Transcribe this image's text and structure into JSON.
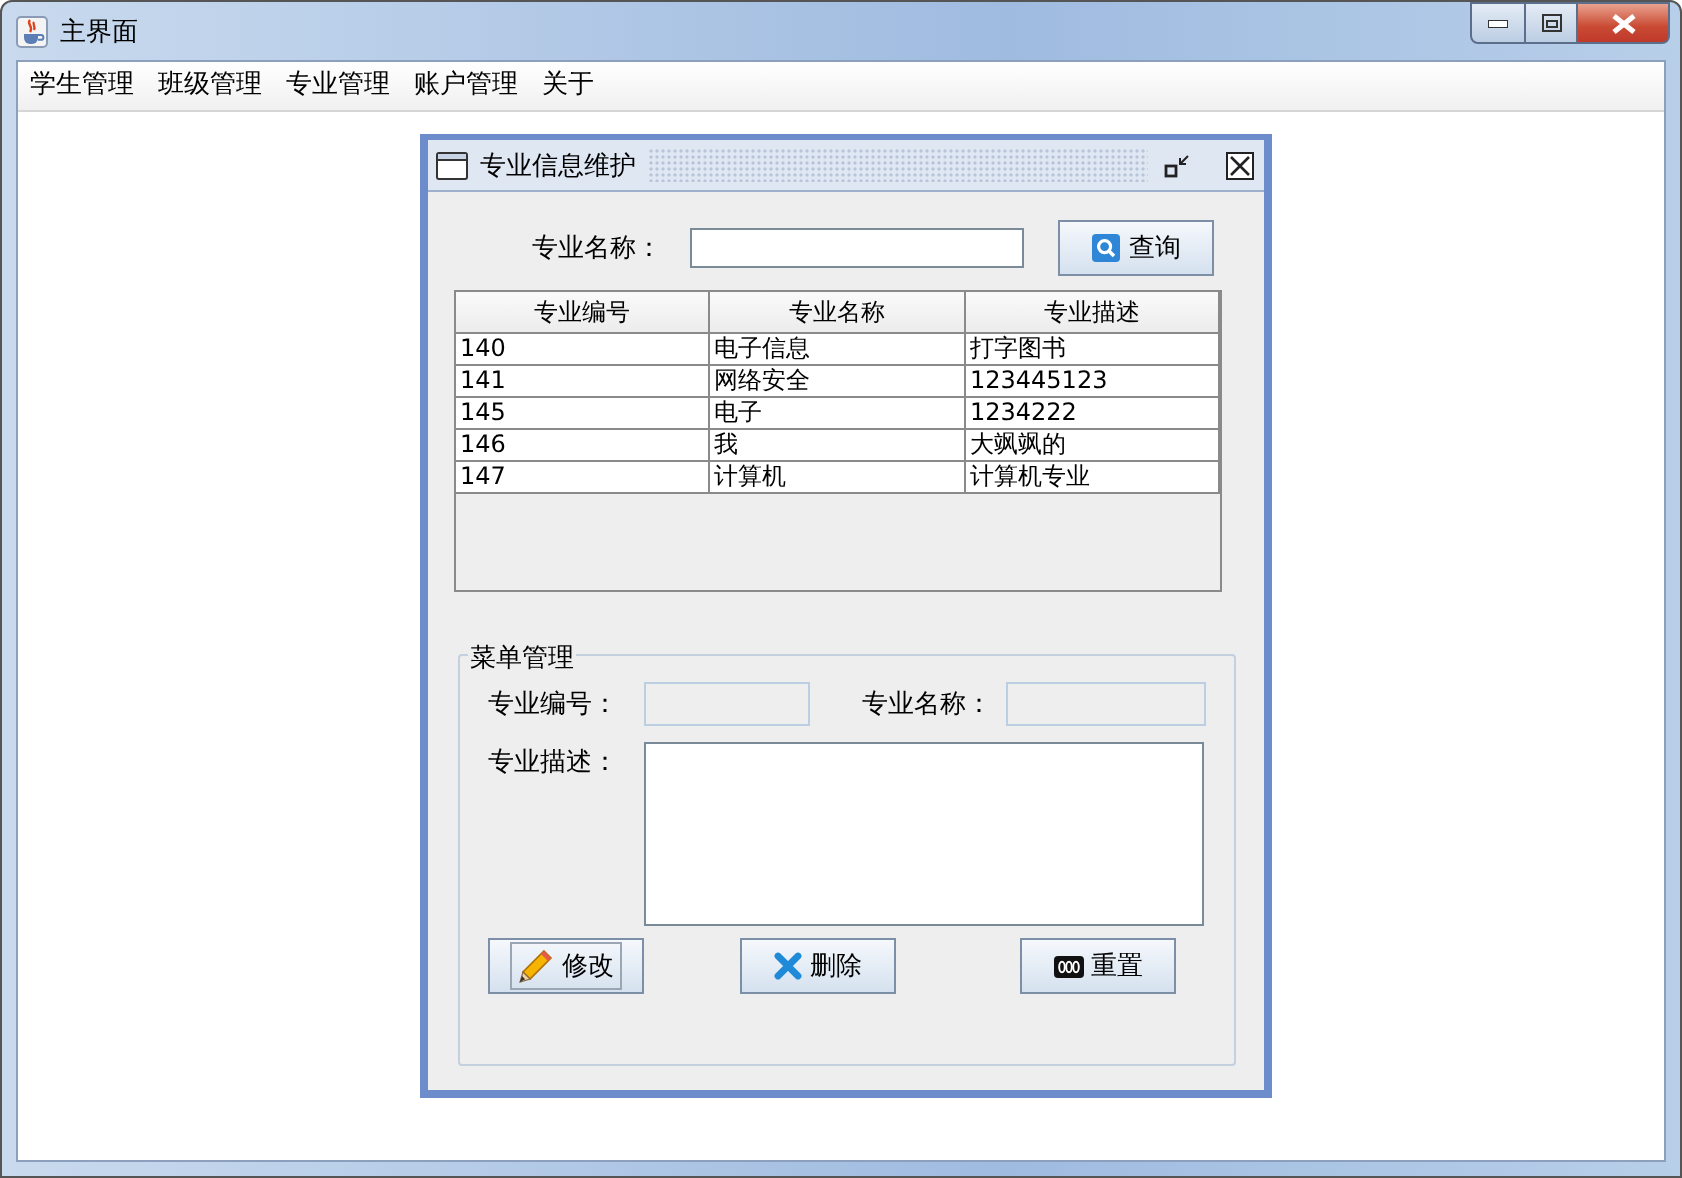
{
  "window": {
    "title": "主界面"
  },
  "menu": [
    {
      "label": "学生管理"
    },
    {
      "label": "班级管理"
    },
    {
      "label": "专业管理"
    },
    {
      "label": "账户管理"
    },
    {
      "label": "关于"
    }
  ],
  "frame": {
    "title": "专业信息维护"
  },
  "search": {
    "label": "专业名称：",
    "button": "查询"
  },
  "table": {
    "columns": [
      "专业编号",
      "专业名称",
      "专业描述"
    ],
    "rows": [
      [
        "140",
        "电子信息",
        "打字图书"
      ],
      [
        "141",
        "网络安全",
        "123445123"
      ],
      [
        "145",
        "电子",
        "1234222"
      ],
      [
        "146",
        "我",
        "大飒飒的"
      ],
      [
        "147",
        "计算机",
        "计算机专业"
      ]
    ]
  },
  "form": {
    "legend": "菜单管理",
    "fields": [
      {
        "label": "专业编号：",
        "kind": "text",
        "disabled": true
      },
      {
        "label": "专业名称：",
        "kind": "text",
        "disabled": true
      },
      {
        "label": "专业描述：",
        "kind": "textarea",
        "disabled": false
      }
    ],
    "buttons": [
      {
        "label": "修改",
        "kind": "edit",
        "focused": true
      },
      {
        "label": "删除",
        "kind": "delete",
        "focused": false
      },
      {
        "label": "重置",
        "kind": "reset",
        "focused": false
      }
    ]
  }
}
